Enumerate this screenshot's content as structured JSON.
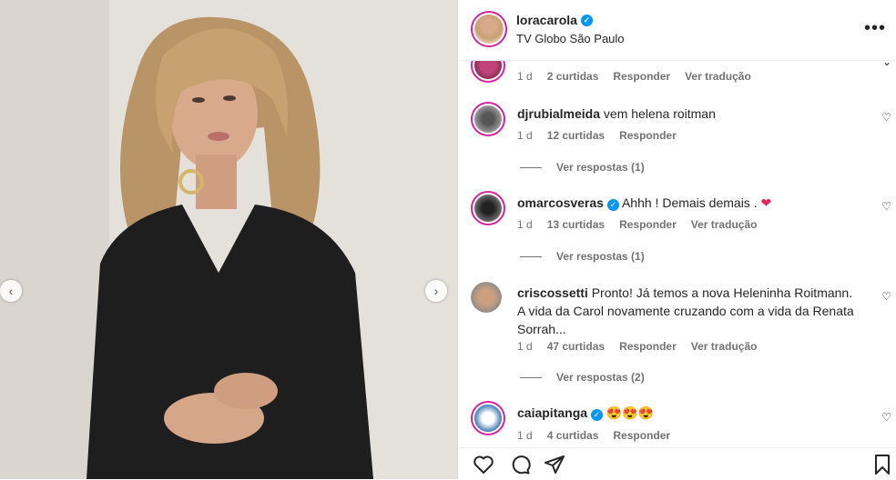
{
  "post": {
    "username": "loracarola",
    "location": "TV Globo São Paulo",
    "more_label": "•••"
  },
  "comments": [
    {
      "user": "",
      "text": "",
      "time": "1 d",
      "likes": "2 curtidas",
      "reply": "Responder",
      "translate": "Ver tradução"
    },
    {
      "user": "djrubialmeida",
      "text": "vem helena roitman",
      "time": "1 d",
      "likes": "12 curtidas",
      "reply": "Responder",
      "replies": "Ver respostas (1)"
    },
    {
      "user": "omarcosveras",
      "text": "Ahhh ! Demais demais .",
      "emoji": "❤",
      "time": "1 d",
      "likes": "13 curtidas",
      "reply": "Responder",
      "translate": "Ver tradução",
      "replies": "Ver respostas (1)"
    },
    {
      "user": "criscossetti",
      "text": "Pronto! Já temos a nova Heleninha Roitmann. A vida da Carol novamente cruzando com a vida da Renata Sorrah...",
      "time": "1 d",
      "likes": "47 curtidas",
      "reply": "Responder",
      "translate": "Ver tradução",
      "replies": "Ver respostas (2)"
    },
    {
      "user": "caiapitanga",
      "emoji": "😍😍😍",
      "time": "1 d",
      "likes": "4 curtidas",
      "reply": "Responder"
    }
  ],
  "icons": {
    "prev": "chevron-left-icon",
    "next": "chevron-right-icon",
    "like": "heart-icon",
    "comment": "comment-icon",
    "share": "share-icon",
    "save": "bookmark-icon"
  },
  "colors": {
    "verified": "#0095f6",
    "story_ring": "#d6249f",
    "heart_red": "#ed4956"
  }
}
